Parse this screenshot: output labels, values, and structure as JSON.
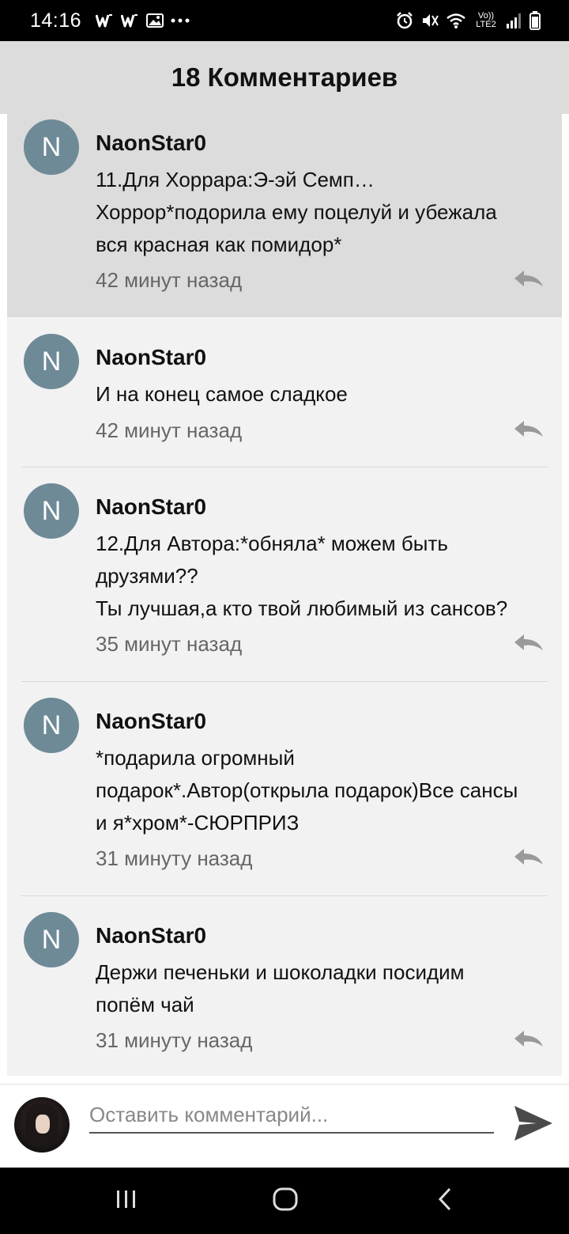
{
  "status_bar": {
    "time": "14:16",
    "left_icons": [
      "w-notification-icon",
      "w-notification-icon",
      "gallery-icon",
      "more-dots-icon"
    ],
    "network_label": "Vo)) LTE2"
  },
  "header": {
    "title": "18 Комментариев"
  },
  "comments": [
    {
      "avatar_letter": "N",
      "author": "NaonStar0",
      "lines": [
        "11.Для Хоррара:Э-эй Семп…",
        "Хоррор*подорила ему поцелуй и убежала",
        "вся красная как помидор*"
      ],
      "time": "42 минут назад",
      "highlighted": true
    },
    {
      "avatar_letter": "N",
      "author": "NaonStar0",
      "lines": [
        "И на конец самое сладкое"
      ],
      "time": "42 минут назад",
      "highlighted": false
    },
    {
      "avatar_letter": "N",
      "author": "NaonStar0",
      "lines": [
        "12.Для Автора:*обняла* можем быть",
        "друзями??",
        "Ты лучшая,а кто твой любимый из сансов?"
      ],
      "time": "35 минут назад",
      "highlighted": false
    },
    {
      "avatar_letter": "N",
      "author": "NaonStar0",
      "lines": [
        "*подарила огромный",
        "подарок*.Автор(открыла подарок)Все сансы",
        "и я*хром*-СЮРПРИЗ"
      ],
      "time": "31 минуту назад",
      "highlighted": false
    },
    {
      "avatar_letter": "N",
      "author": "NaonStar0",
      "lines": [
        "Держи печеньки и шоколадки посидим",
        "попём чай"
      ],
      "time": "31 минуту назад",
      "highlighted": false
    }
  ],
  "comment_input": {
    "placeholder": "Оставить комментарий..."
  },
  "colors": {
    "avatar_bg": "#6e8a97",
    "header_bg": "#dcdcdc",
    "highlight_bg": "#dcdcdc",
    "list_bg": "#f2f2f2",
    "timestamp": "#666666"
  }
}
